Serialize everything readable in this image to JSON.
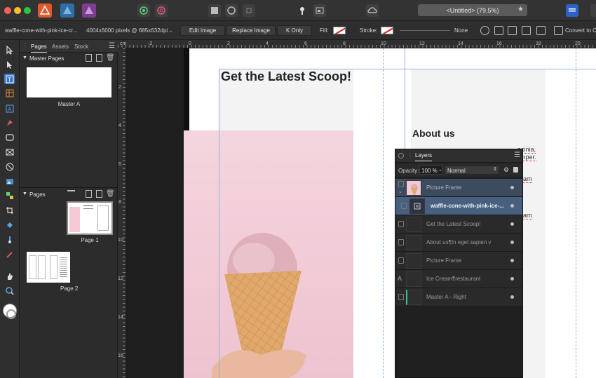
{
  "titlebar": {
    "doc_title": "<Untitled> (79.5%)"
  },
  "context_toolbar": {
    "filename": "waffle-cone-with-pink-ice-cr...",
    "image_info": "4004x6000 pixels @ 685x632dpi",
    "edit_image": "Edit Image",
    "replace_image": "Replace Image",
    "k_only": "K Only",
    "fill_label": "Fill:",
    "stroke_label": "Stroke:",
    "stroke_value": "None",
    "convert_to": "Convert to C"
  },
  "pages_panel": {
    "tabs": [
      "Pages",
      "Assets",
      "Stock"
    ],
    "master_pages_label": "Master Pages",
    "master_a_label": "Master A",
    "pages_label": "Pages",
    "page1_label": "Page 1",
    "page2_label": "Page 2"
  },
  "ruler": {
    "unit": "cm",
    "h_ticks": [
      "-2",
      "0",
      "2",
      "4",
      "6",
      "8",
      "10",
      "12",
      "14",
      "16",
      "18",
      "20"
    ],
    "v_ticks": [
      "2",
      "4",
      "6",
      "8",
      "10",
      "12",
      "14",
      "16"
    ]
  },
  "document": {
    "headline": "Get the Latest Scoop!",
    "about_heading": "About us",
    "snippet_1": "acinia,",
    "snippet_2": "mper.",
    "snippet_3": "am",
    "snippet_4": "am"
  },
  "layers_panel": {
    "title": "Layers",
    "opacity_label": "Opacity:",
    "opacity_value": "100 %",
    "blend_mode": "Normal",
    "rows": [
      {
        "name": "Picture Frame"
      },
      {
        "name": "waffle-cone-with-pink-ice-..."
      },
      {
        "name": "Get the Latest Scoop!"
      },
      {
        "name": "About us¶In eget sapien v"
      },
      {
        "name": "Picture Frame"
      },
      {
        "name": "Ice Cream¶restaurant"
      },
      {
        "name": "Master A - Right"
      }
    ]
  },
  "colors": {
    "accent_blue": "#2c62c4",
    "selection_row": "#47607f"
  }
}
